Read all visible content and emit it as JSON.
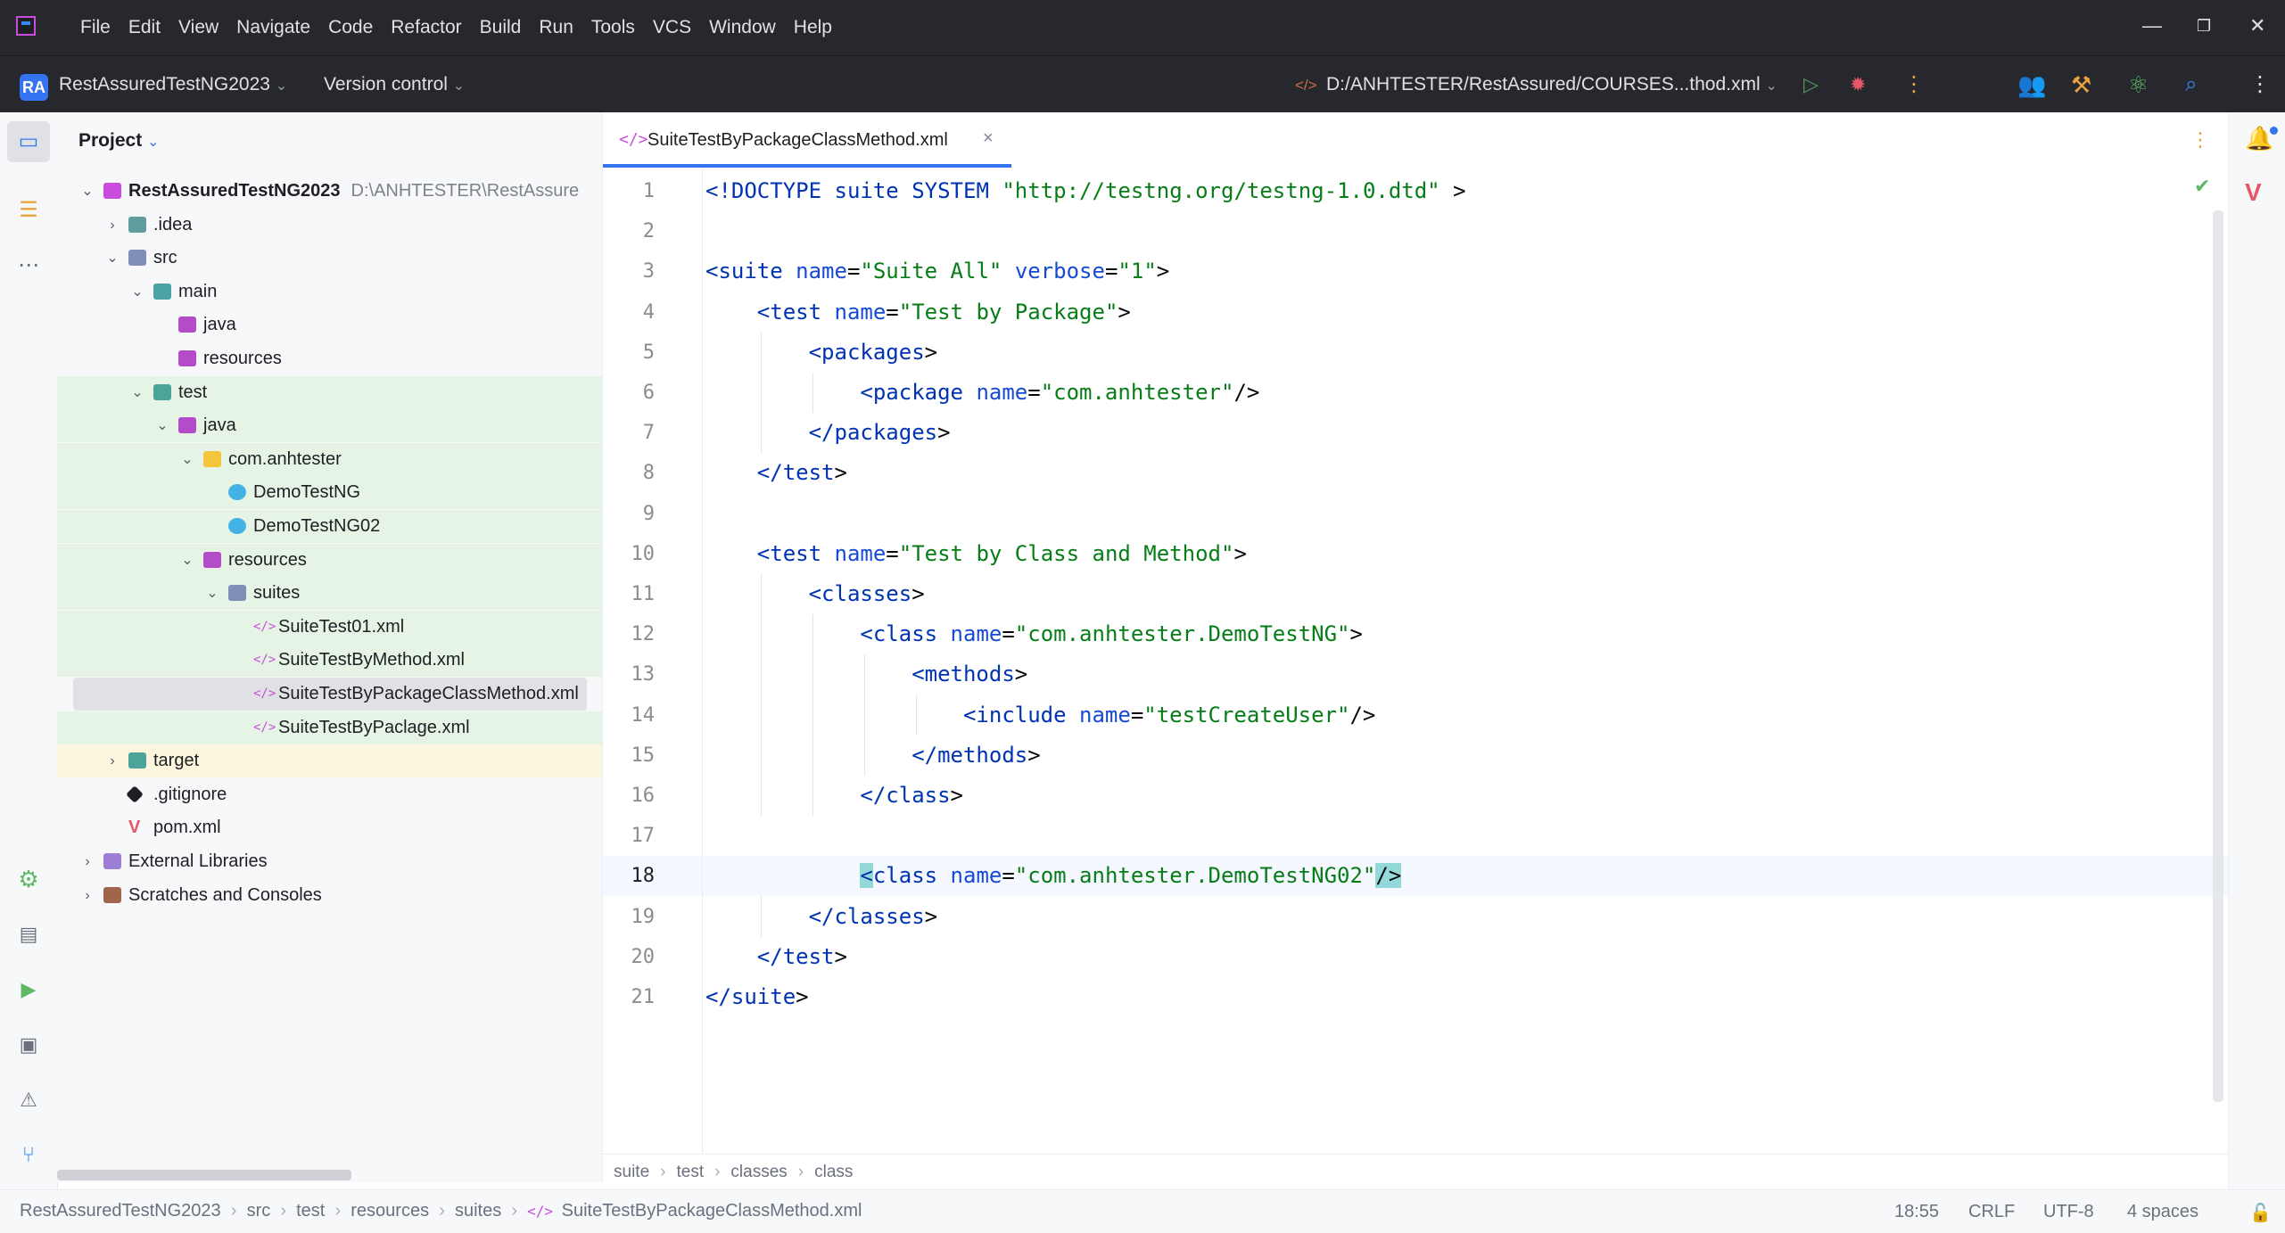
{
  "titlebar": {
    "menu": [
      "File",
      "Edit",
      "View",
      "Navigate",
      "Code",
      "Refactor",
      "Build",
      "Run",
      "Tools",
      "VCS",
      "Window",
      "Help"
    ],
    "minimize": "—",
    "restore": "❐",
    "close": "✕"
  },
  "toolbar": {
    "project_badge": "RA",
    "project_name": "RestAssuredTestNG2023",
    "version_control": "Version control",
    "run_config": "D:/ANHTESTER/RestAssured/COURSES...thod.xml"
  },
  "project_panel": {
    "header": "Project",
    "tree": [
      {
        "label": "RestAssuredTestNG2023",
        "path": "D:\\ANHTESTER\\RestAssure",
        "arrow": "⌄",
        "icon": "folder-module-icon"
      },
      {
        "label": ".idea",
        "arrow": "›",
        "icon": "folder-idea-icon"
      },
      {
        "label": "src",
        "arrow": "⌄",
        "icon": "folder-icon"
      },
      {
        "label": "main",
        "arrow": "⌄",
        "icon": "folder-source-icon"
      },
      {
        "label": "java",
        "arrow": "",
        "icon": "folder-java-icon"
      },
      {
        "label": "resources",
        "arrow": "",
        "icon": "folder-resources-icon"
      },
      {
        "label": "test",
        "arrow": "⌄",
        "icon": "folder-test-icon"
      },
      {
        "label": "java",
        "arrow": "⌄",
        "icon": "folder-java-icon"
      },
      {
        "label": "com.anhtester",
        "arrow": "⌄",
        "icon": "package-icon"
      },
      {
        "label": "DemoTestNG",
        "arrow": "",
        "icon": "class-icon"
      },
      {
        "label": "DemoTestNG02",
        "arrow": "",
        "icon": "class-icon"
      },
      {
        "label": "resources",
        "arrow": "⌄",
        "icon": "folder-resources-icon"
      },
      {
        "label": "suites",
        "arrow": "⌄",
        "icon": "folder-icon"
      },
      {
        "label": "SuiteTest01.xml",
        "arrow": "",
        "icon": "xml-file-icon"
      },
      {
        "label": "SuiteTestByMethod.xml",
        "arrow": "",
        "icon": "xml-file-icon"
      },
      {
        "label": "SuiteTestByPackageClassMethod.xml",
        "arrow": "",
        "icon": "xml-file-icon"
      },
      {
        "label": "SuiteTestByPaclage.xml",
        "arrow": "",
        "icon": "xml-file-icon"
      },
      {
        "label": "target",
        "arrow": "›",
        "icon": "folder-excluded-icon"
      },
      {
        "label": ".gitignore",
        "arrow": "",
        "icon": "git-icon"
      },
      {
        "label": "pom.xml",
        "arrow": "",
        "icon": "maven-icon"
      },
      {
        "label": "External Libraries",
        "arrow": "›",
        "icon": "libraries-icon"
      },
      {
        "label": "Scratches and Consoles",
        "arrow": "›",
        "icon": "scratches-icon"
      }
    ]
  },
  "editor": {
    "tab_label": "SuiteTestByPackageClassMethod.xml",
    "tab_icon": "</>",
    "tab_close": "×",
    "current_line": 18,
    "lines": [
      {
        "n": "1",
        "code": "<!DOCTYPE suite SYSTEM \"http://testng.org/testng-1.0.dtd\" >"
      },
      {
        "n": "2",
        "code": ""
      },
      {
        "n": "3",
        "code": "<suite name=\"Suite All\" verbose=\"1\">"
      },
      {
        "n": "4",
        "code": "    <test name=\"Test by Package\">"
      },
      {
        "n": "5",
        "code": "        <packages>"
      },
      {
        "n": "6",
        "code": "            <package name=\"com.anhtester\"/>"
      },
      {
        "n": "7",
        "code": "        </packages>"
      },
      {
        "n": "8",
        "code": "    </test>"
      },
      {
        "n": "9",
        "code": ""
      },
      {
        "n": "10",
        "code": "    <test name=\"Test by Class and Method\">"
      },
      {
        "n": "11",
        "code": "        <classes>"
      },
      {
        "n": "12",
        "code": "            <class name=\"com.anhtester.DemoTestNG\">"
      },
      {
        "n": "13",
        "code": "                <methods>"
      },
      {
        "n": "14",
        "code": "                    <include name=\"testCreateUser\"/>"
      },
      {
        "n": "15",
        "code": "                </methods>"
      },
      {
        "n": "16",
        "code": "            </class>"
      },
      {
        "n": "17",
        "code": ""
      },
      {
        "n": "18",
        "code": "            <class name=\"com.anhtester.DemoTestNG02\"/>"
      },
      {
        "n": "19",
        "code": "        </classes>"
      },
      {
        "n": "20",
        "code": "    </test>"
      },
      {
        "n": "21",
        "code": "</suite>"
      }
    ]
  },
  "breadcrumb": [
    "suite",
    "test",
    "classes",
    "class"
  ],
  "statusbar": {
    "path": [
      "RestAssuredTestNG2023",
      "src",
      "test",
      "resources",
      "suites",
      "SuiteTestByPackageClassMethod.xml"
    ],
    "position": "18:55",
    "line_sep": "CRLF",
    "encoding": "UTF-8",
    "indent": "4 spaces"
  },
  "colors": {
    "accent": "#3574f0",
    "tag": "#0033b3",
    "string": "#067d17",
    "test_green_bg": "#e6f4e6",
    "excluded_yellow_bg": "#fcf6de"
  }
}
